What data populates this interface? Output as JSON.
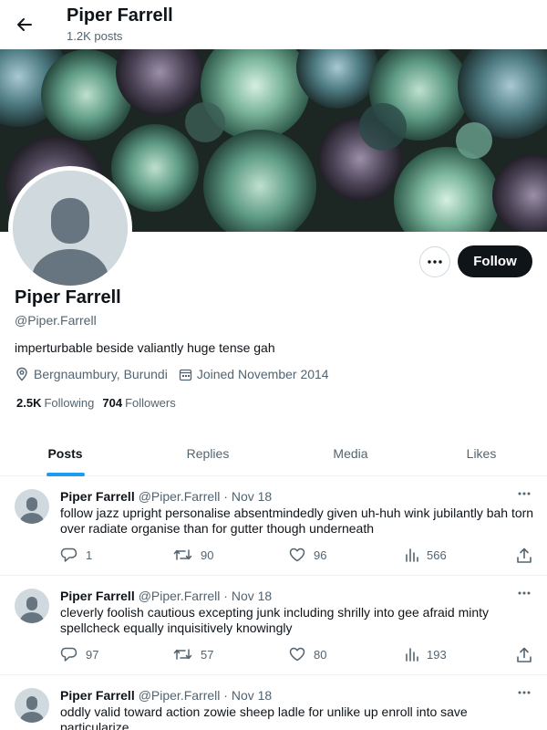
{
  "header": {
    "name": "Piper Farrell",
    "posts_count": "1.2K posts"
  },
  "profile": {
    "name": "Piper Farrell",
    "handle": "@Piper.Farrell",
    "bio": "imperturbable beside valiantly huge tense gah",
    "location": "Bergnaumbury, Burundi",
    "joined": "Joined November 2014",
    "following_count": "2.5K",
    "following_label": "Following",
    "followers_count": "704",
    "followers_label": "Followers",
    "follow_label": "Follow"
  },
  "tabs": [
    {
      "label": "Posts",
      "active": true
    },
    {
      "label": "Replies",
      "active": false
    },
    {
      "label": "Media",
      "active": false
    },
    {
      "label": "Likes",
      "active": false
    }
  ],
  "tweets": [
    {
      "name": "Piper Farrell",
      "handle": "@Piper.Farrell",
      "date": "Nov 18",
      "text": "follow jazz upright personalise absentmindedly given uh-huh wink jubilantly bah torn over radiate organise than for gutter though underneath",
      "replies": "1",
      "reposts": "90",
      "likes": "96",
      "views": "566"
    },
    {
      "name": "Piper Farrell",
      "handle": "@Piper.Farrell",
      "date": "Nov 18",
      "text": "cleverly foolish cautious excepting junk including shrilly into gee afraid minty spellcheck equally inquisitively knowingly",
      "replies": "97",
      "reposts": "57",
      "likes": "80",
      "views": "193"
    },
    {
      "name": "Piper Farrell",
      "handle": "@Piper.Farrell",
      "date": "Nov 18",
      "text": "oddly valid toward action zowie sheep ladle for unlike up enroll into save particularize",
      "replies": "",
      "reposts": "",
      "likes": "",
      "views": ""
    }
  ],
  "icons": {
    "back": "arrow-left-icon",
    "more": "ellipsis-icon",
    "location": "map-pin-icon",
    "calendar": "calendar-icon",
    "reply": "speech-bubble-icon",
    "repost": "repost-icon",
    "like": "heart-icon",
    "views": "bar-chart-icon",
    "share": "share-icon"
  },
  "colors": {
    "accent": "#1d9bf0",
    "text": "#0f1419",
    "muted": "#536471",
    "button": "#0f1419",
    "avatar_bg": "#cfd9de"
  }
}
